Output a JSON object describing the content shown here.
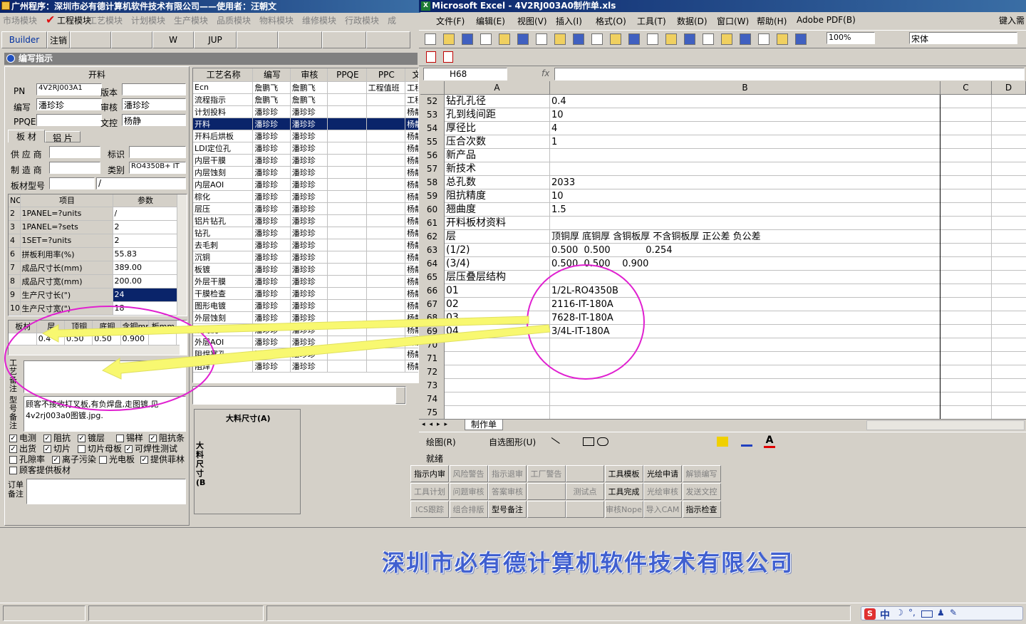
{
  "app": {
    "title": "广州程序：深圳市必有德计算机软件技术有限公司——使用者：汪朝文",
    "menu": [
      "市场模块",
      "工程模块",
      "工艺模块",
      "计划模块",
      "生产模块",
      "品质模块",
      "物料模块",
      "维修模块",
      "行政模块",
      "成"
    ],
    "toolbar": [
      "Builder",
      "注销",
      "",
      "",
      "W",
      "JUP",
      "",
      "",
      "",
      ""
    ],
    "dialog_title": "编写指示",
    "section": "开料",
    "pn_label": "PN",
    "pn": "4V2RJ003A1",
    "ver_label": "版本",
    "ver": "",
    "write_label": "编写",
    "write": "潘珍珍",
    "review_label": "审核",
    "review": "潘珍珍",
    "pque_label": "PPQE",
    "pque": "",
    "control_label": "文控",
    "control": "杨静",
    "tabs": [
      "板 材",
      "铝 片"
    ],
    "supplier_label": "供 应 商",
    "mark_label": "标识",
    "maker_label": "制 造 商",
    "class_label": "类别",
    "class_val": "RO4350B+ IT",
    "model_label": "板材型号",
    "model_val": "/",
    "param_headers": [
      "NO",
      "项目",
      "参数"
    ],
    "params": [
      [
        "2",
        "1PANEL=?units",
        "/"
      ],
      [
        "3",
        "1PANEL=?sets",
        "2"
      ],
      [
        "4",
        "1SET=?units",
        "2"
      ],
      [
        "6",
        "拼板利用率(%)",
        "55.83"
      ],
      [
        "7",
        "成品尺寸长(mm)",
        "389.00"
      ],
      [
        "8",
        "成品尺寸宽(mm)",
        "200.00"
      ],
      [
        "9",
        "生产尺寸长(\")",
        "24"
      ],
      [
        "10",
        "生产尺寸宽(\")",
        "18"
      ]
    ],
    "layer_headers": [
      "板材",
      "层",
      "顶铜",
      "底铜",
      "含铜mm",
      "板mm"
    ],
    "layer_row": [
      "",
      "0.4",
      "0.50",
      "0.50",
      "0.900",
      ""
    ],
    "notes_label": "工艺备注",
    "model_note_label": "型号备注",
    "note_text": "顾客不接收打叉板,有负焊盘,走图镀,见4v2rj003a0图镀.jpg.",
    "checks": [
      [
        "电测",
        true
      ],
      [
        "阻抗",
        true
      ],
      [
        "镀层",
        true
      ],
      [
        "锡样",
        false
      ],
      [
        "阻抗条",
        true
      ],
      [
        "出货",
        true
      ],
      [
        "切片",
        true
      ],
      [
        "切片母板",
        false
      ],
      [
        "可焊性测试",
        true
      ],
      [
        "孔隙率",
        false
      ],
      [
        "离子污染",
        true
      ],
      [
        "光电板",
        false
      ],
      [
        "提供菲林",
        true
      ],
      [
        "顾客提供板材",
        false
      ]
    ],
    "order_note_label": "订单备注",
    "proc_headers": [
      "工艺名称",
      "编写",
      "审核",
      "PPQE",
      "PPC",
      "文控"
    ],
    "procs": [
      [
        "Ecn",
        "詹鹏飞",
        "詹鹏飞",
        "",
        "工程值班",
        "工程"
      ],
      [
        "流程指示",
        "詹鹏飞",
        "詹鹏飞",
        "",
        "",
        "工程"
      ],
      [
        "计划投料",
        "潘珍珍",
        "潘珍珍",
        "",
        "",
        "杨静"
      ],
      [
        "开料",
        "潘珍珍",
        "潘珍珍",
        "",
        "",
        "杨静"
      ],
      [
        "开料后烘板",
        "潘珍珍",
        "潘珍珍",
        "",
        "",
        "杨静"
      ],
      [
        "LDI定位孔",
        "潘珍珍",
        "潘珍珍",
        "",
        "",
        "杨静"
      ],
      [
        "内层干膜",
        "潘珍珍",
        "潘珍珍",
        "",
        "",
        "杨静"
      ],
      [
        "内层蚀刻",
        "潘珍珍",
        "潘珍珍",
        "",
        "",
        "杨静"
      ],
      [
        "内层AOI",
        "潘珍珍",
        "潘珍珍",
        "",
        "",
        "杨静"
      ],
      [
        "棕化",
        "潘珍珍",
        "潘珍珍",
        "",
        "",
        "杨静"
      ],
      [
        "层压",
        "潘珍珍",
        "潘珍珍",
        "",
        "",
        "杨静"
      ],
      [
        "铝片钻孔",
        "潘珍珍",
        "潘珍珍",
        "",
        "",
        "杨静"
      ],
      [
        "钻孔",
        "潘珍珍",
        "潘珍珍",
        "",
        "",
        "杨静"
      ],
      [
        "去毛刺",
        "潘珍珍",
        "潘珍珍",
        "",
        "",
        "杨静"
      ],
      [
        "沉铜",
        "潘珍珍",
        "潘珍珍",
        "",
        "",
        "杨静"
      ],
      [
        "板镀",
        "潘珍珍",
        "潘珍珍",
        "",
        "",
        "杨静"
      ],
      [
        "外层干膜",
        "潘珍珍",
        "潘珍珍",
        "",
        "",
        "杨静"
      ],
      [
        "干膜检查",
        "潘珍珍",
        "潘珍珍",
        "",
        "",
        "杨静"
      ],
      [
        "图形电镀",
        "潘珍珍",
        "潘珍珍",
        "",
        "",
        "杨静"
      ],
      [
        "外层蚀刻",
        "潘珍珍",
        "潘珍珍",
        "",
        "",
        "杨静"
      ],
      [
        "蚀刻洗",
        "潘珍珍",
        "潘珍珍",
        "",
        "",
        "杨静"
      ],
      [
        "外层AOI",
        "潘珍珍",
        "潘珍珍",
        "",
        "",
        "杨静"
      ],
      [
        "阻焊塞孔",
        "潘珍珍",
        "潘珍珍",
        "",
        "",
        "杨静"
      ],
      [
        "阻焊",
        "潘珍珍",
        "潘珍珍",
        "",
        "",
        "杨静"
      ]
    ],
    "size_a": "大料尺寸(A)",
    "size_b": "大料尺寸(B)",
    "bottom_buttons": [
      "指示内审",
      "风险警告",
      "指示退审",
      "工厂警告",
      "",
      "工具模板",
      "光绘申请",
      "解锁编写",
      "工具计划",
      "问题审核",
      "答案审核",
      "",
      "测试点",
      "工具完成",
      "光绘审核",
      "发送文控",
      "ICS跟踪",
      "组合排版",
      "型号备注",
      "",
      "",
      "审核Nope",
      "导入CAM",
      "指示检查"
    ],
    "company": "深圳市必有德计算机软件技术有限公司",
    "right_hint": "键入需"
  },
  "excel": {
    "title": "Microsoft Excel - 4V2RJ003A0制作单.xls",
    "menu": [
      "文件(F)",
      "编辑(E)",
      "视图(V)",
      "插入(I)",
      "格式(O)",
      "工具(T)",
      "数据(D)",
      "窗口(W)",
      "帮助(H)",
      "Adobe PDF(B)"
    ],
    "zoom": "100%",
    "font": "宋体",
    "namebox": "H68",
    "fx": "fx",
    "cols": [
      "A",
      "B",
      "C",
      "D"
    ],
    "rows": [
      [
        "52",
        "钻孔孔径",
        "0.4"
      ],
      [
        "53",
        "孔到线间距",
        "10"
      ],
      [
        "54",
        "厚径比",
        "4"
      ],
      [
        "55",
        "压合次数",
        "1"
      ],
      [
        "56",
        "新产品",
        ""
      ],
      [
        "57",
        "新技术",
        ""
      ],
      [
        "58",
        "总孔数",
        "2033"
      ],
      [
        "59",
        "阻抗精度",
        "10"
      ],
      [
        "60",
        "翘曲度",
        "1.5"
      ],
      [
        "61",
        "开料板材资料",
        ""
      ],
      [
        "62",
        "层",
        "顶铜厚 底铜厚 含铜板厚 不含铜板厚 正公差 负公差"
      ],
      [
        "63",
        "(1/2)",
        "0.500  0.500            0.254"
      ],
      [
        "64",
        "(3/4)",
        "0.500  0.500    0.900"
      ],
      [
        "65",
        "层压叠层结构",
        ""
      ],
      [
        "66",
        "01",
        "1/2L-RO4350B"
      ],
      [
        "67",
        "02",
        "2116-IT-180A"
      ],
      [
        "68",
        "03",
        "7628-IT-180A"
      ],
      [
        "69",
        "04",
        "3/4L-IT-180A"
      ],
      [
        "70",
        "",
        ""
      ],
      [
        "71",
        "",
        ""
      ],
      [
        "72",
        "",
        ""
      ],
      [
        "73",
        "",
        ""
      ],
      [
        "74",
        "",
        ""
      ],
      [
        "75",
        "",
        ""
      ]
    ],
    "sheet_tab": "制作单",
    "draw_label": "绘图(R)",
    "autoshape": "自选图形(U)",
    "status": "就绪"
  },
  "taskbar": {
    "ime": "中"
  }
}
